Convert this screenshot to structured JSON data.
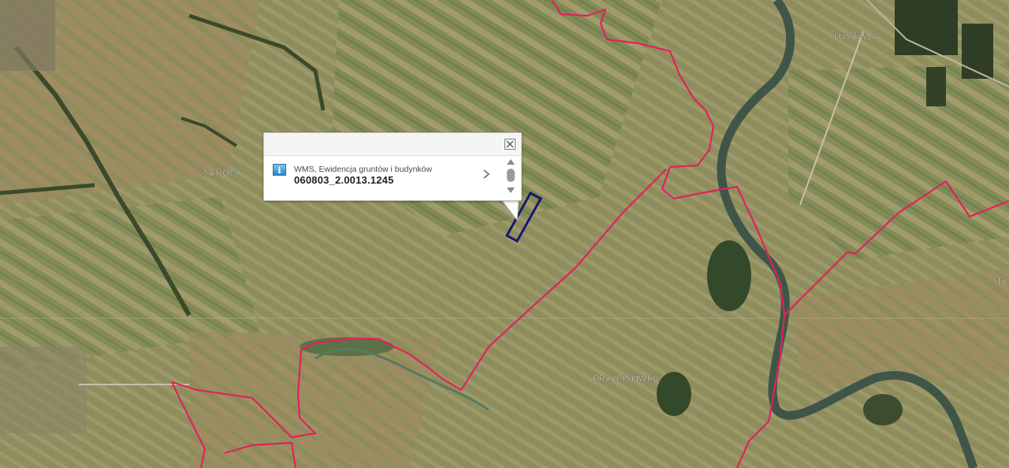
{
  "map": {
    "place_labels": [
      {
        "id": "serock",
        "text": "SEROCK"
      },
      {
        "id": "luszawa",
        "text": "LUSZAWA"
      },
      {
        "id": "przypisowka",
        "text": "PRZYPISÓWKA"
      },
      {
        "id": "ty",
        "text": "TY"
      }
    ],
    "colors": {
      "boundary": "#e0225f",
      "parcel_highlight": "#141a6e",
      "river": "#3f5548"
    }
  },
  "popup": {
    "layer_name": "WMS, Ewidencja gruntów i budynków",
    "parcel_id": "060803_2.0013.1245",
    "icons": {
      "info": "info-icon",
      "close": "close-icon",
      "next": "chevron-right-icon",
      "scroll_up": "arrow-up-icon",
      "scroll_down": "arrow-down-icon"
    },
    "info_glyph": "i"
  }
}
